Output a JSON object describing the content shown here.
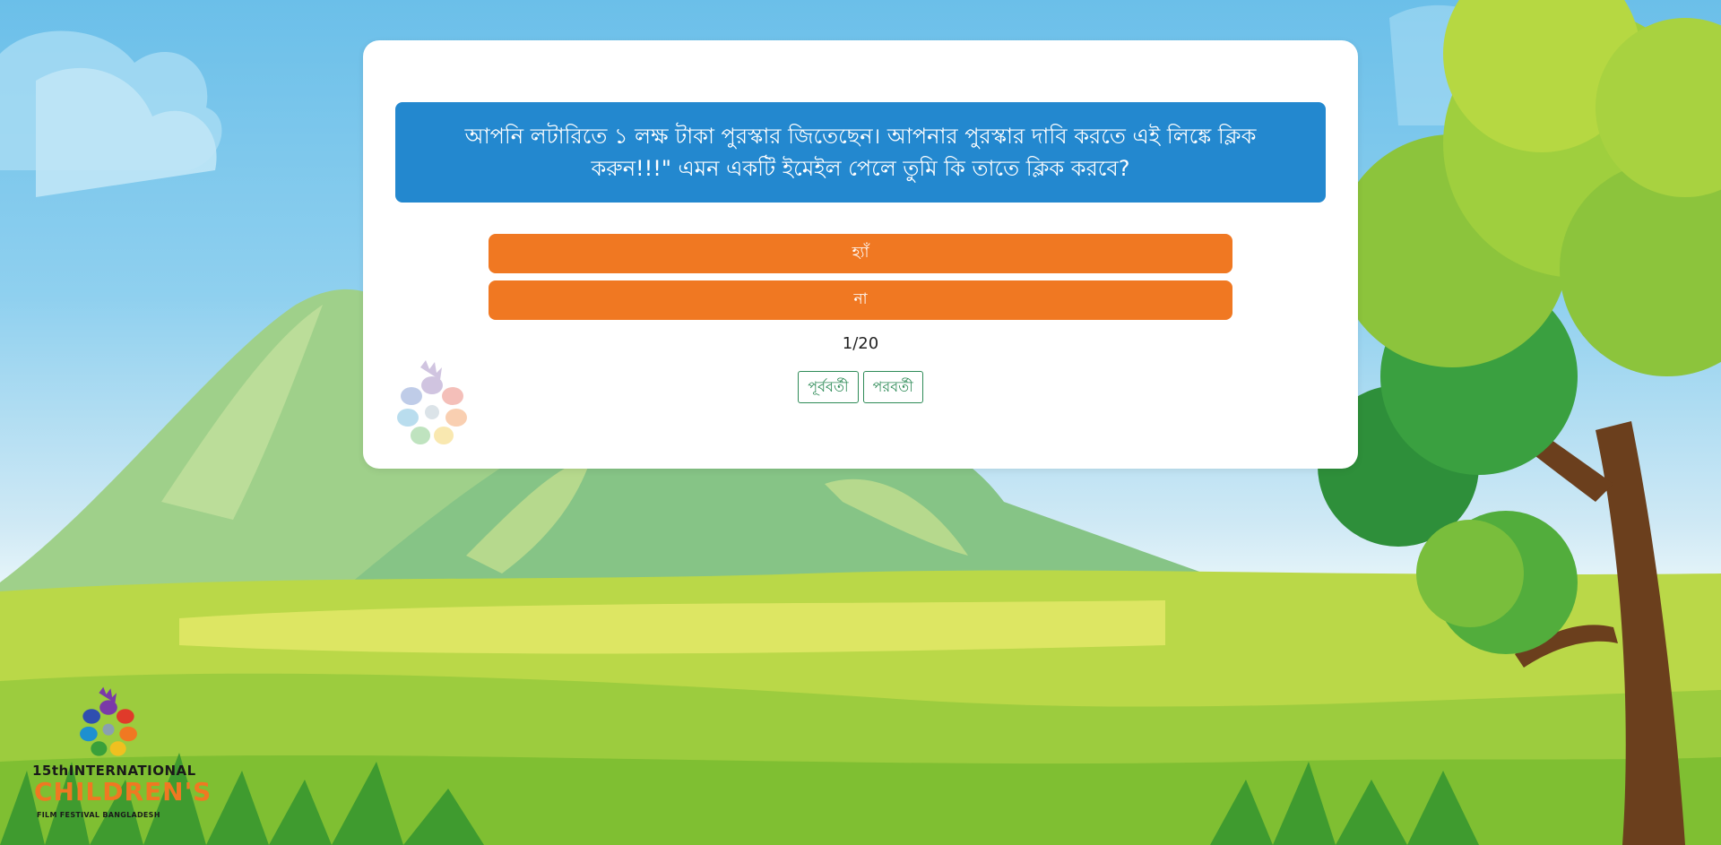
{
  "quiz": {
    "question": "আপনি লটারিতে ১ লক্ষ টাকা পুরস্কার জিতেছেন। আপনার পুরস্কার দাবি করতে এই লিঙ্কে ক্লিক করুন!!!\" এমন একটি ইমেইল পেলে তুমি কি তাতে ক্লিক করবে?",
    "options": [
      "হ্যাঁ",
      "না"
    ],
    "progress": "1/20",
    "prev_label": "পূর্ববর্তী",
    "next_label": "পরবর্তী"
  },
  "logo": {
    "line1": "15thINTERNATIONAL",
    "line2": "CHILDREN'S",
    "line3": "FILM FESTIVAL BANGLADESH"
  },
  "colors": {
    "question_bg": "#2388cf",
    "option_bg": "#f07822",
    "nav_border": "#2e8b57"
  }
}
